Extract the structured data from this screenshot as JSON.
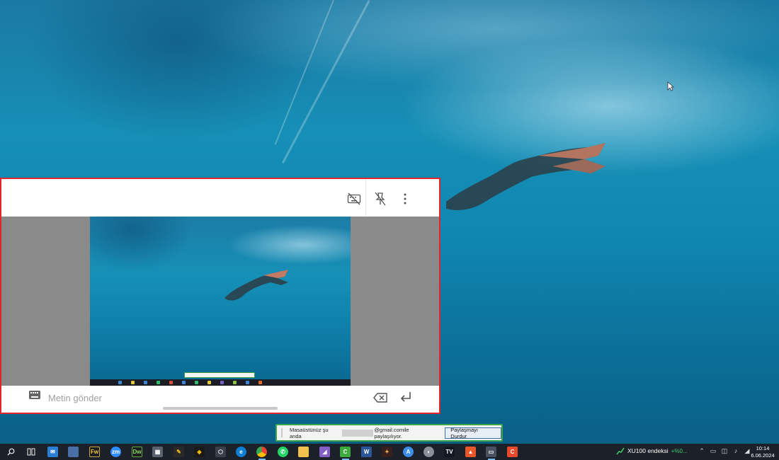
{
  "desktop": {
    "wallpaper": "underwater-freediver"
  },
  "viewer": {
    "border_color": "#e0262d",
    "toolbar": {
      "icons": [
        "keyboard-off-icon",
        "unpin-icon",
        "more-vertical-icon"
      ]
    },
    "footer": {
      "placeholder": "Metin gönder",
      "icons": [
        "keyboard-icon",
        "backspace-icon",
        "enter-icon"
      ]
    }
  },
  "share_bar": {
    "text_before": "Masaüstünüz şu anda",
    "text_after": "@gmail.comile paylaşılıyor.",
    "stop_button": "Paylaşmayı Durdur",
    "border_color": "#3aa54b"
  },
  "taskbar": {
    "stock_widget": {
      "name": "XU100 endeksi",
      "change": "+%0..."
    },
    "clock": {
      "time": "10:14",
      "date": "6.06.2024"
    }
  }
}
